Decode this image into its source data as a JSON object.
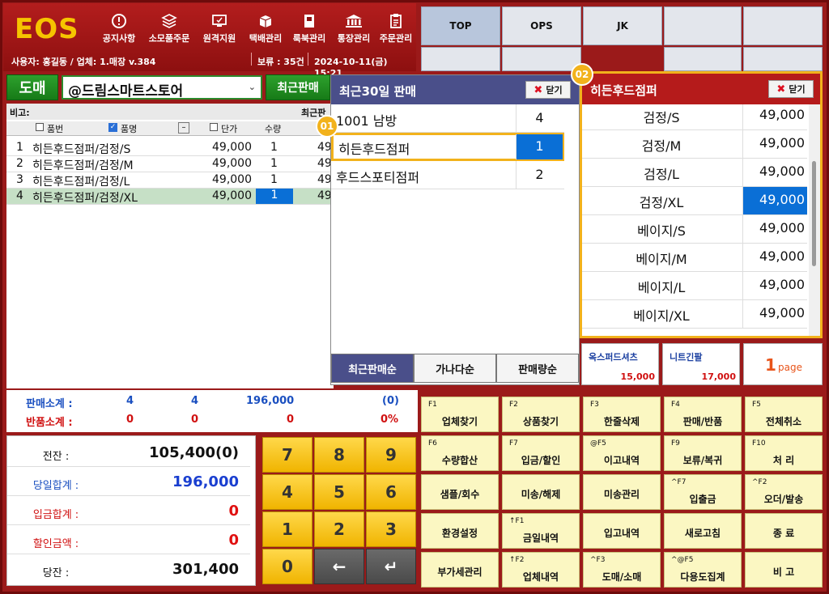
{
  "header": {
    "logo": "EOS",
    "buttons": [
      "공지사항",
      "소모품주문",
      "원격지원",
      "택배관리",
      "룩북관리",
      "통장관리",
      "주문관리"
    ],
    "user_info": "사용자: 홍길동 / 업체: 1.매장 v.384",
    "hold": "보류 : 35건",
    "datetime": "2024-10-11(금) 15:21"
  },
  "top_grid": [
    "TOP",
    "OPS",
    "JK",
    "",
    ""
  ],
  "search": {
    "mode_button": "도매",
    "store": "@드림스마트스토어",
    "recent_button": "최근판매"
  },
  "left_table": {
    "remark_label": "비고:",
    "remark_right": "최근판",
    "headers": {
      "code": "품번",
      "name": "품명",
      "price": "단가",
      "qty": "수량"
    },
    "rows": [
      {
        "no": "1",
        "name": "히든후드점퍼/검정/S",
        "price": "49,000",
        "qty": "1",
        "amt": "49"
      },
      {
        "no": "2",
        "name": "히든후드점퍼/검정/M",
        "price": "49,000",
        "qty": "1",
        "amt": "49"
      },
      {
        "no": "3",
        "name": "히든후드점퍼/검정/L",
        "price": "49,000",
        "qty": "1",
        "amt": "49"
      },
      {
        "no": "4",
        "name": "히든후드점퍼/검정/XL",
        "price": "49,000",
        "qty": "1",
        "amt": "49"
      }
    ]
  },
  "totals": {
    "sale_label": "판매소계 :",
    "sale_a": "4",
    "sale_b": "4",
    "sale_amt": "196,000",
    "sale_pct": "(0)",
    "ret_label": "반품소계 :",
    "ret_a": "0",
    "ret_b": "0",
    "ret_amt": "0",
    "ret_pct": "0%"
  },
  "summary": [
    {
      "label": "전잔 :",
      "value": "105,400(0)"
    },
    {
      "label": "당일합계 :",
      "value": "196,000"
    },
    {
      "label": "입금합계 :",
      "value": "0"
    },
    {
      "label": "할인금액 :",
      "value": "0"
    },
    {
      "label": "당잔 :",
      "value": "301,400"
    }
  ],
  "numpad": [
    "7",
    "8",
    "9",
    "4",
    "5",
    "6",
    "1",
    "2",
    "3",
    "0",
    "←",
    "↵"
  ],
  "popup_recent": {
    "badge": "01",
    "title": "최근30일 판매",
    "close": "닫기",
    "rows": [
      {
        "name": "1001 남방",
        "qty": "4"
      },
      {
        "name": "히든후드점퍼",
        "qty": "1"
      },
      {
        "name": "후드스포티점퍼",
        "qty": "2"
      }
    ],
    "tabs": [
      "최근판매순",
      "가나다순",
      "판매량순"
    ]
  },
  "popup_options": {
    "badge": "02",
    "title": "히든후드점퍼",
    "close": "닫기",
    "rows": [
      {
        "name": "검정/S",
        "price": "49,000"
      },
      {
        "name": "검정/M",
        "price": "49,000"
      },
      {
        "name": "검정/L",
        "price": "49,000"
      },
      {
        "name": "검정/XL",
        "price": "49,000"
      },
      {
        "name": "베이지/S",
        "price": "49,000"
      },
      {
        "name": "베이지/M",
        "price": "49,000"
      },
      {
        "name": "베이지/L",
        "price": "49,000"
      },
      {
        "name": "베이지/XL",
        "price": "49,000"
      }
    ]
  },
  "products": [
    {
      "name": "옥스퍼드셔츠",
      "price": "15,000"
    },
    {
      "name": "니트긴팔",
      "price": "17,000"
    }
  ],
  "page": {
    "num": "1",
    "label": "page"
  },
  "functions": [
    {
      "key": "F1",
      "label": "업체찾기"
    },
    {
      "key": "F2",
      "label": "상품찾기"
    },
    {
      "key": "F3",
      "label": "한줄삭제"
    },
    {
      "key": "F4",
      "label": "판매/반품"
    },
    {
      "key": "F5",
      "label": "전체취소"
    },
    {
      "key": "F6",
      "label": "수량합산"
    },
    {
      "key": "F7",
      "label": "입금/할인"
    },
    {
      "key": "@F5",
      "label": "이고내역"
    },
    {
      "key": "F9",
      "label": "보류/복귀"
    },
    {
      "key": "F10",
      "label": "처  리"
    },
    {
      "key": "",
      "label": "샘플/회수"
    },
    {
      "key": "",
      "label": "미송/해제"
    },
    {
      "key": "",
      "label": "미송관리"
    },
    {
      "key": "^F7",
      "label": "입출금"
    },
    {
      "key": "^F2",
      "label": "오더/발송"
    },
    {
      "key": "",
      "label": "환경설정"
    },
    {
      "key": "↑F1",
      "label": "금일내역"
    },
    {
      "key": "",
      "label": "입고내역"
    },
    {
      "key": "",
      "label": "새로고침"
    },
    {
      "key": "",
      "label": "종  료"
    },
    {
      "key": "",
      "label": "부가세관리"
    },
    {
      "key": "↑F2",
      "label": "업체내역"
    },
    {
      "key": "^F3",
      "label": "도매/소매"
    },
    {
      "key": "^@F5",
      "label": "다용도집계"
    },
    {
      "key": "",
      "label": "비  고"
    }
  ],
  "colors": {
    "accent_red": "#9b1a1a",
    "logo_yellow": "#f6c400",
    "popup_header": "#4a4f8a",
    "highlight": "#f2b21c",
    "select_blue": "#0a6fd6"
  }
}
